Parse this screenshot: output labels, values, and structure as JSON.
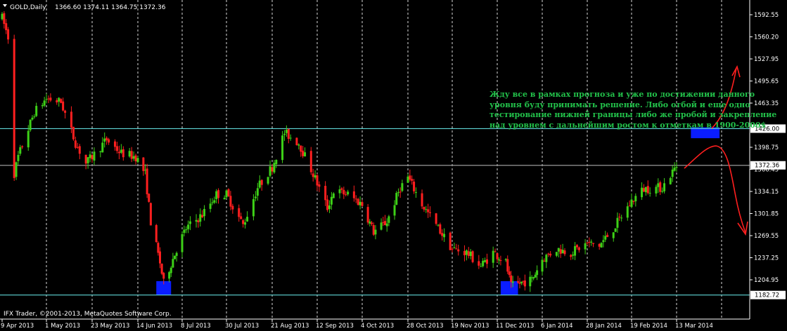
{
  "header": {
    "symbol": "GOLD,Daily",
    "ohlc": "1366.60 1374.11 1364.75 1372.36"
  },
  "copyright": "IFX Trader, ©2001-2013, MetaQuotes Software Corp.",
  "annotation": {
    "lines": [
      "Жду все в рамках прогноза и уже по достижении данного",
      "уровня буду принимать решение. Либо отбой и еще одно",
      "тестирование нижней границы либо же пробой и закрепление",
      "над уровнем с дальнейшим ростом к отметкам в 1900-2000$"
    ]
  },
  "colors": {
    "background": "#000000",
    "bull": "#3dd017",
    "bear": "#ff1f1f",
    "grid": "#ffffff",
    "level_line": "#5fd6d6",
    "zone": "#0a1dff",
    "arrow": "#ff1f1f",
    "text": "#ffffff",
    "annotation": "#22c14a",
    "tag_bg": "#ffffff",
    "tag_text": "#000000"
  },
  "chart_data": {
    "type": "candlestick",
    "instrument": "GOLD",
    "timeframe": "Daily",
    "ylim": [
      1170,
      1605
    ],
    "y_ticks": [
      1592.55,
      1560.2,
      1527.95,
      1495.65,
      1463.35,
      1398.75,
      1366.45,
      1334.15,
      1301.85,
      1269.55,
      1237.25,
      1204.95
    ],
    "highlighted_levels": [
      {
        "value": 1426.0,
        "label": "1426.00"
      },
      {
        "value": 1372.36,
        "label": "1372.36"
      },
      {
        "value": 1182.72,
        "label": "1182.72"
      }
    ],
    "x_labels": [
      "9 Apr 2013",
      "1 May 2013",
      "23 May 2013",
      "14 Jun 2013",
      "8 Jul 2013",
      "30 Jul 2013",
      "21 Aug 2013",
      "12 Sep 2013",
      "4 Oct 2013",
      "28 Oct 2013",
      "19 Nov 2013",
      "11 Dec 2013",
      "6 Jan 2014",
      "28 Jan 2014",
      "19 Feb 2014",
      "13 Mar 2014"
    ],
    "grid": "vertical dashed",
    "price_path": [
      [
        "9 Apr 2013",
        1588
      ],
      [
        "12 Apr 2013",
        1560
      ],
      [
        "15 Apr 2013",
        1360
      ],
      [
        "17 Apr 2013",
        1385
      ],
      [
        "25 Apr 2013",
        1450
      ],
      [
        "1 May 2013",
        1470
      ],
      [
        "8 May 2013",
        1465
      ],
      [
        "15 May 2013",
        1405
      ],
      [
        "20 May 2013",
        1375
      ],
      [
        "23 May 2013",
        1385
      ],
      [
        "30 May 2013",
        1410
      ],
      [
        "6 Jun 2013",
        1390
      ],
      [
        "13 Jun 2013",
        1385
      ],
      [
        "18 Jun 2013",
        1360
      ],
      [
        "21 Jun 2013",
        1290
      ],
      [
        "26 Jun 2013",
        1230
      ],
      [
        "28 Jun 2013",
        1200
      ],
      [
        "5 Jul 2013",
        1250
      ],
      [
        "10 Jul 2013",
        1280
      ],
      [
        "18 Jul 2013",
        1300
      ],
      [
        "25 Jul 2013",
        1330
      ],
      [
        "30 Jul 2013",
        1330
      ],
      [
        "7 Aug 2013",
        1285
      ],
      [
        "14 Aug 2013",
        1340
      ],
      [
        "21 Aug 2013",
        1370
      ],
      [
        "27 Aug 2013",
        1420
      ],
      [
        "3 Sep 2013",
        1405
      ],
      [
        "10 Sep 2013",
        1360
      ],
      [
        "17 Sep 2013",
        1310
      ],
      [
        "20 Sep 2013",
        1335
      ],
      [
        "27 Sep 2013",
        1330
      ],
      [
        "4 Oct 2013",
        1315
      ],
      [
        "10 Oct 2013",
        1275
      ],
      [
        "17 Oct 2013",
        1290
      ],
      [
        "24 Oct 2013",
        1340
      ],
      [
        "28 Oct 2013",
        1355
      ],
      [
        "4 Nov 2013",
        1315
      ],
      [
        "11 Nov 2013",
        1285
      ],
      [
        "19 Nov 2013",
        1250
      ],
      [
        "26 Nov 2013",
        1245
      ],
      [
        "3 Dec 2013",
        1225
      ],
      [
        "9 Dec 2013",
        1245
      ],
      [
        "16 Dec 2013",
        1230
      ],
      [
        "19 Dec 2013",
        1195
      ],
      [
        "24 Dec 2013",
        1200
      ],
      [
        "31 Dec 2013",
        1205
      ],
      [
        "6 Jan 2014",
        1235
      ],
      [
        "13 Jan 2014",
        1250
      ],
      [
        "20 Jan 2014",
        1245
      ],
      [
        "28 Jan 2014",
        1258
      ],
      [
        "3 Feb 2014",
        1255
      ],
      [
        "10 Feb 2014",
        1280
      ],
      [
        "19 Feb 2014",
        1320
      ],
      [
        "25 Feb 2014",
        1338
      ],
      [
        "6 Mar 2014",
        1340
      ],
      [
        "13 Mar 2014",
        1372
      ]
    ],
    "zones": [
      {
        "price_low": 1182.72,
        "price_high": 1203,
        "date_from": "24 Jun 2013",
        "date_to": "2 Jul 2013"
      },
      {
        "price_low": 1182.72,
        "price_high": 1203,
        "date_from": "13 Dec 2013",
        "date_to": "23 Dec 2013"
      },
      {
        "price_low": 1412,
        "price_high": 1428,
        "date_from": "20 Mar 2014",
        "date_to": "3 Apr 2014"
      }
    ]
  }
}
